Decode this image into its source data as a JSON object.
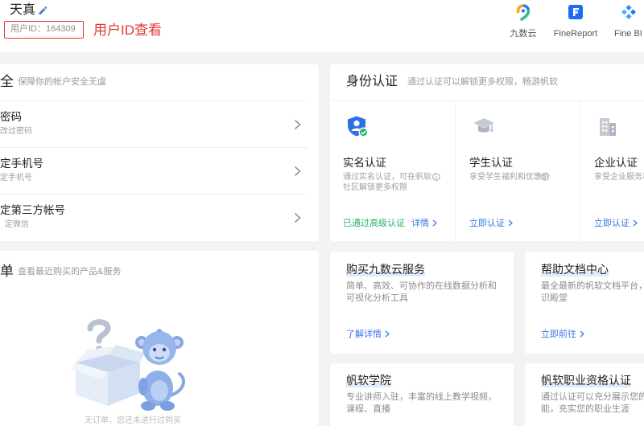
{
  "header": {
    "user_name": "天真",
    "user_id": "用户ID：164309",
    "annotation": "用户ID查看",
    "apps": [
      {
        "label": "九数云",
        "icon": "jiushuyun-logo-icon"
      },
      {
        "label": "FineReport",
        "icon": "finereport-logo-icon"
      },
      {
        "label": "Fine BI",
        "icon": "finebi-logo-icon"
      }
    ]
  },
  "security": {
    "title": "全",
    "subtitle": "保障你的帐户安全无虞",
    "rows": [
      {
        "title": "密码",
        "desc": "改过密码"
      },
      {
        "title": "定手机号",
        "desc": "定手机号"
      },
      {
        "title": "定第三方帐号",
        "desc": "定微信"
      }
    ]
  },
  "orders": {
    "title": "单",
    "subtitle": "查看最近购买的产品&服务",
    "empty_text": "无订单，您还未进行过购买"
  },
  "identity": {
    "title": "身份认证",
    "subtitle": "通过认证可以解锁更多权限，畅游帆软",
    "items": [
      {
        "icon": "shield-user-check-icon",
        "title": "实名认证",
        "desc_lines": [
          "通过实名认证，可在帆软",
          "社区解锁更多权限"
        ],
        "status": "已通过高级认证",
        "link": "详情"
      },
      {
        "icon": "graduation-cap-icon",
        "title": "学生认证",
        "desc_lines": [
          "享受学生福利和优惠价"
        ],
        "link": "立即认证"
      },
      {
        "icon": "building-icon",
        "title": "企业认证",
        "desc_lines": [
          "享受企业服务和"
        ],
        "link": "立即认证"
      }
    ]
  },
  "services": [
    {
      "title": "购买九数云服务",
      "desc_lines": [
        "简单、高效、可协作的在线数据分析和",
        "可视化分析工具"
      ],
      "link": "了解详情"
    },
    {
      "title": "帮助文档中心",
      "desc_lines": [
        "最全最新的帆软文档平台，",
        "识殿堂"
      ],
      "link": "立即前往"
    },
    {
      "title": "帆软学院",
      "desc_lines": [
        "专业讲师入驻，丰富的线上教学视频，",
        "课程、直播"
      ]
    },
    {
      "title": "帆软职业资格认证",
      "desc_lines": [
        "通过认证可以充分展示您的",
        "能，充实您的职业生涯"
      ]
    }
  ],
  "colors": {
    "accent_blue": "#3577e6",
    "success_green": "#21b36a",
    "annotation_red": "#e3382f",
    "page_bg": "#f2f3f5"
  }
}
